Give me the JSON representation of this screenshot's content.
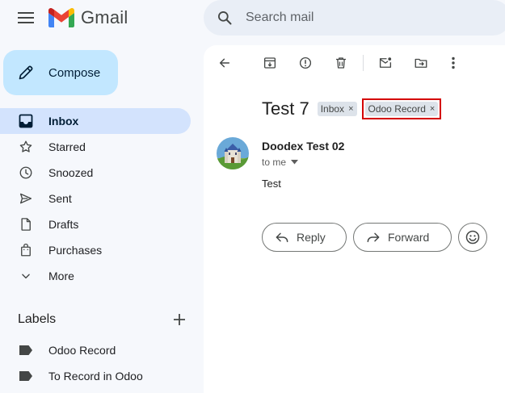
{
  "header": {
    "app_name": "Gmail",
    "search_placeholder": "Search mail"
  },
  "sidebar": {
    "compose_label": "Compose",
    "items": [
      {
        "label": "Inbox",
        "icon": "inbox-icon",
        "active": true
      },
      {
        "label": "Starred",
        "icon": "star-icon"
      },
      {
        "label": "Snoozed",
        "icon": "clock-icon"
      },
      {
        "label": "Sent",
        "icon": "send-icon"
      },
      {
        "label": "Drafts",
        "icon": "draft-icon"
      },
      {
        "label": "Purchases",
        "icon": "shopping-bag-icon"
      },
      {
        "label": "More",
        "icon": "chevron-down-icon"
      }
    ],
    "labels_title": "Labels",
    "labels": [
      {
        "label": "Odoo Record",
        "icon": "label-icon"
      },
      {
        "label": "To Record in Odoo",
        "icon": "label-icon"
      }
    ]
  },
  "email": {
    "subject": "Test 7",
    "chips": [
      {
        "label": "Inbox",
        "close": "×"
      },
      {
        "label": "Odoo Record",
        "close": "×",
        "highlighted": true
      }
    ],
    "sender": "Doodex Test 02",
    "to": "to me",
    "body": "Test",
    "reply_label": "Reply",
    "forward_label": "Forward"
  },
  "colors": {
    "background": "#f6f8fc",
    "compose": "#c2e7ff",
    "active_nav": "#d3e3fd",
    "highlight_border": "#d40000"
  }
}
